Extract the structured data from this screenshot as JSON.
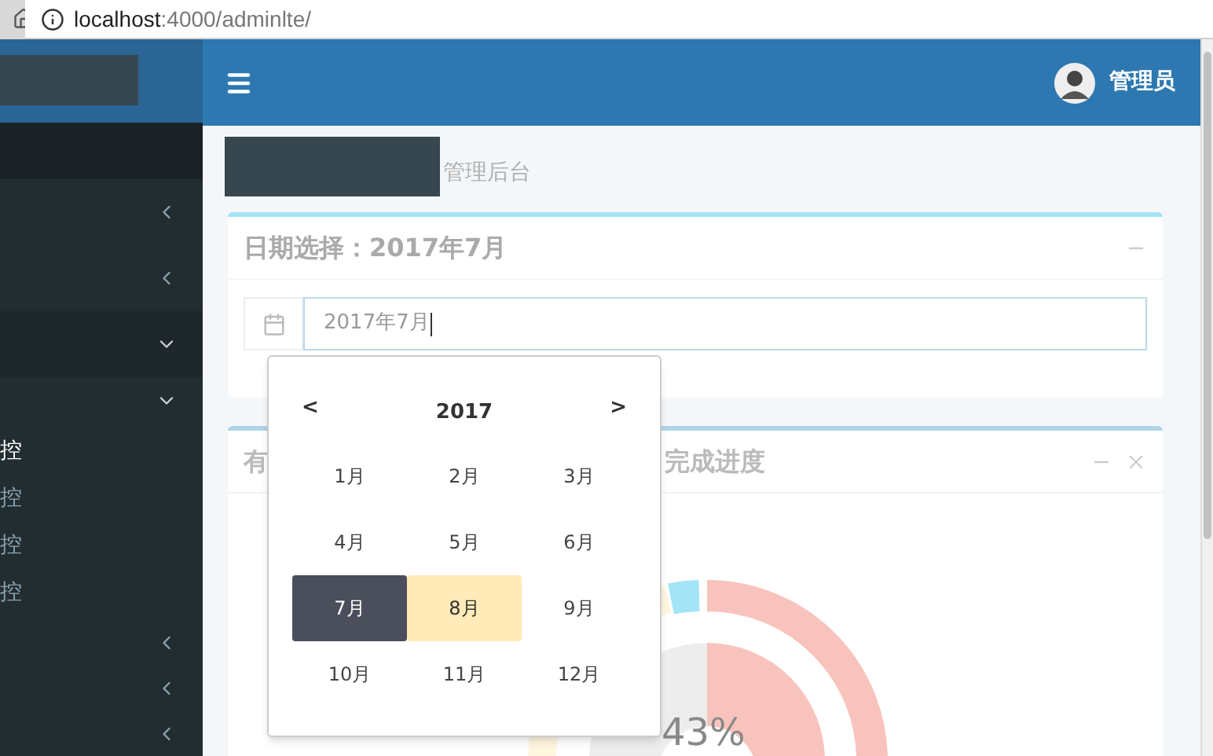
{
  "browser": {
    "url_host": "localhost",
    "url_path": ":4000/adminlte/"
  },
  "header": {
    "user_name": "管理员"
  },
  "sidebar": {
    "items": [
      {
        "expanded": false,
        "active": false
      },
      {
        "expanded": false,
        "active": false
      },
      {
        "expanded": true,
        "active": true
      },
      {
        "expanded": true,
        "active": false,
        "children": [
          {
            "label": "控",
            "selected": true
          },
          {
            "label": "控",
            "selected": false
          },
          {
            "label": "控",
            "selected": false
          },
          {
            "label": "控",
            "selected": false
          }
        ]
      },
      {
        "expanded": false,
        "active": false
      },
      {
        "expanded": false,
        "active": false
      },
      {
        "expanded": false,
        "active": false
      }
    ]
  },
  "content_header": {
    "subtitle": "管理后台"
  },
  "date_card": {
    "title": "日期选择：2017年7月",
    "input_value": "2017年7月"
  },
  "picker": {
    "prev": "<",
    "year": "2017",
    "next": ">",
    "months": [
      {
        "label": "1月",
        "selected": false,
        "highlighted": false
      },
      {
        "label": "2月",
        "selected": false,
        "highlighted": false
      },
      {
        "label": "3月",
        "selected": false,
        "highlighted": false
      },
      {
        "label": "4月",
        "selected": false,
        "highlighted": false
      },
      {
        "label": "5月",
        "selected": false,
        "highlighted": false
      },
      {
        "label": "6月",
        "selected": false,
        "highlighted": false
      },
      {
        "label": "7月",
        "selected": true,
        "highlighted": false
      },
      {
        "label": "8月",
        "selected": false,
        "highlighted": true
      },
      {
        "label": "9月",
        "selected": false,
        "highlighted": false
      },
      {
        "label": "10月",
        "selected": false,
        "highlighted": false
      },
      {
        "label": "11月",
        "selected": false,
        "highlighted": false
      },
      {
        "label": "12月",
        "selected": false,
        "highlighted": false
      }
    ]
  },
  "progress_card": {
    "title_start": "有",
    "title_end": "完成进度",
    "center_label": "43%"
  }
}
